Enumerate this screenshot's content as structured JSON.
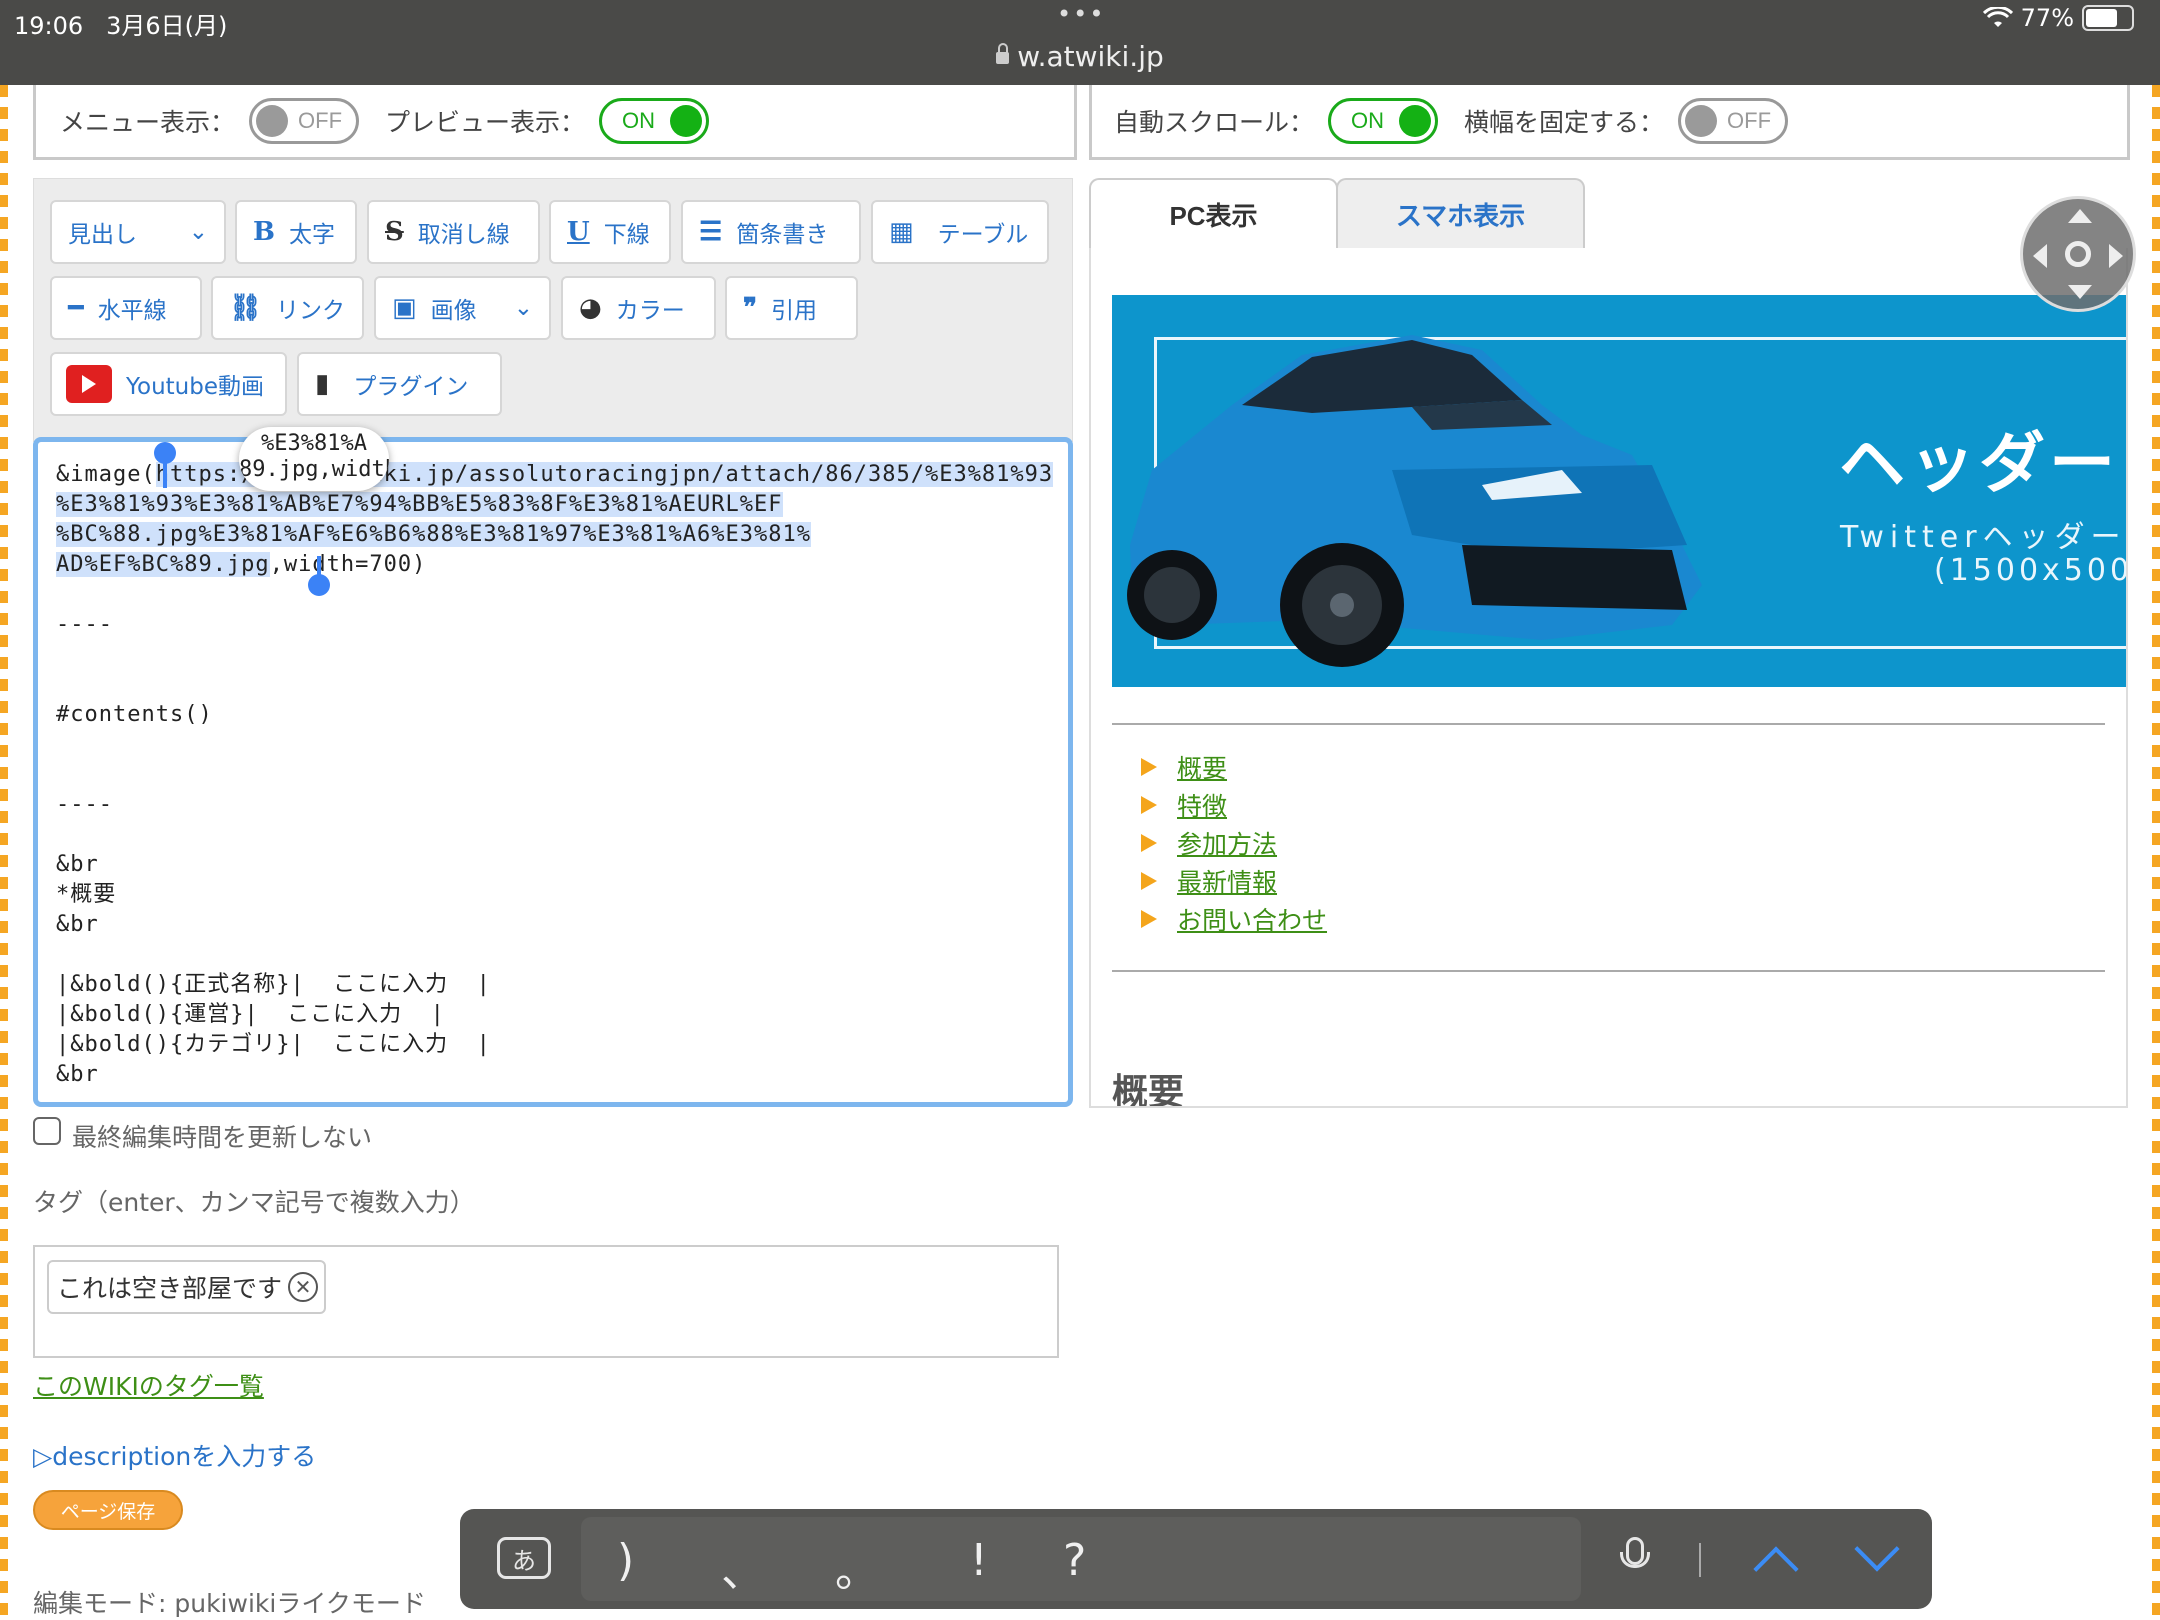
{
  "statusbar": {
    "time": "19:06",
    "date": "3月6日(月)",
    "dots": "•••",
    "url": "w.atwiki.jp",
    "battery": "77%",
    "battery_level": 0.77
  },
  "options_left": {
    "menu_label": "メニュー表示：",
    "menu_state": "OFF",
    "preview_label": "プレビュー表示：",
    "preview_state": "ON"
  },
  "options_right": {
    "autoscroll_label": "自動スクロール：",
    "autoscroll_state": "ON",
    "fixwidth_label": "横幅を固定する：",
    "fixwidth_state": "OFF"
  },
  "toolbar": {
    "heading": "見出し",
    "bold": "太字",
    "strike": "取消し線",
    "underline": "下線",
    "bullets": "箇条書き",
    "table": "テーブル",
    "hr": "水平線",
    "link": "リンク",
    "image": "画像",
    "color": "カラー",
    "quote": "引用",
    "youtube": "Youtube動画",
    "plugin": "プラグイン"
  },
  "editor": {
    "line1_a": "&image(",
    "line1_sel": "https://img.atwiki.jp/assolutoracingjpn/attach/86/385/%E3%81%93",
    "line2_sel": "%E3%81%93%E3%81%AB%E7%94%BB%E5%83%8F%E3%81%AEURL%EF",
    "line3_sel": "%BC%88.jpg%E3%81%AF%E6%B6%88%E3%81%97%E3%81%A6%E3%81%",
    "line4_sel": "AD%EF%BC%89.jpg",
    "line4_b": ",width=700)",
    "rest": "\n\n----\n\n\n#contents()\n\n\n----\n\n&br\n*概要\n&br\n\n|&bold(){正式名称}|  ここに入力  |\n|&bold(){運営}|  ここに入力  |\n|&bold(){カテゴリ}|  ここに入力  |\n&br",
    "magnifier_line1": "%E3%81%A",
    "magnifier_line2": "89.jpg,width"
  },
  "preview": {
    "tab_pc": "PC表示",
    "tab_sp": "スマホ表示",
    "banner_title": "ヘッダー",
    "banner_sub1": "Twitterヘッダー",
    "banner_sub2": "(1500x500",
    "toc": [
      "概要",
      "特徴",
      "参加方法",
      "最新情報",
      "お問い合わせ"
    ],
    "section_heading": "概要"
  },
  "form": {
    "no_update_label": "最終編集時間を更新しない",
    "tag_hint": "タグ（enter、カンマ記号で複数入力）",
    "tag_chip": "これは空き部屋です",
    "tag_list_link": "このWIKIのタグ一覧",
    "description_link": "▷descriptionを入力する",
    "save_button": "ページ保存",
    "edit_mode": "編集モード: pukiwikiライクモード"
  },
  "keyboard_bar": {
    "input_mode": "あ",
    "candidates": [
      ")",
      "、",
      "。",
      "!",
      "?"
    ]
  },
  "colors": {
    "link_green": "#3e8f16",
    "link_blue": "#2a73c8",
    "toggle_on": "#14b114",
    "accent_orange": "#f6a33b",
    "banner_blue": "#0d95cc"
  }
}
